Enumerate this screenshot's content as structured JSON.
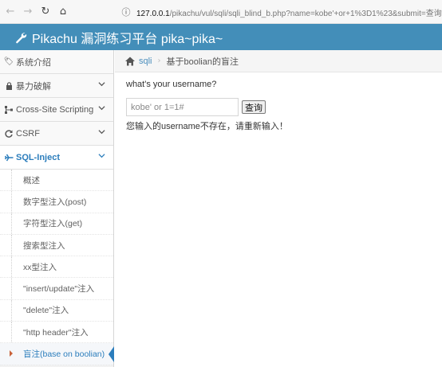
{
  "browser": {
    "url_host": "127.0.0.1",
    "url_path": "/pikachu/vul/sqli/sqli_blind_b.php?name=kobe'+or+1%3D1%23&submit=查询"
  },
  "app": {
    "title": "Pikachu 漏洞练习平台 pika~pika~",
    "header_color": "#438eb9"
  },
  "sidebar": {
    "items": [
      {
        "label": "系统介绍",
        "icon": "tag-icon"
      },
      {
        "label": "暴力破解",
        "icon": "lock-icon"
      },
      {
        "label": "Cross-Site Scripting",
        "icon": "sitemap-icon"
      },
      {
        "label": "CSRF",
        "icon": "refresh-icon"
      },
      {
        "label": "SQL-Inject",
        "icon": "plane-icon"
      }
    ],
    "sub_items": [
      {
        "label": "概述"
      },
      {
        "label": "数字型注入(post)"
      },
      {
        "label": "字符型注入(get)"
      },
      {
        "label": "搜索型注入"
      },
      {
        "label": "xx型注入"
      },
      {
        "label": "\"insert/update\"注入"
      },
      {
        "label": "\"delete\"注入"
      },
      {
        "label": "\"http header\"注入"
      },
      {
        "label": "盲注(base on boolian)"
      }
    ]
  },
  "breadcrumb": {
    "link": "sqli",
    "current": "基于boolian的盲注"
  },
  "main": {
    "prompt": "what's your username?",
    "input_value": "kobe' or 1=1#",
    "submit_label": "查询",
    "result": "您输入的username不存在，请重新输入！"
  }
}
